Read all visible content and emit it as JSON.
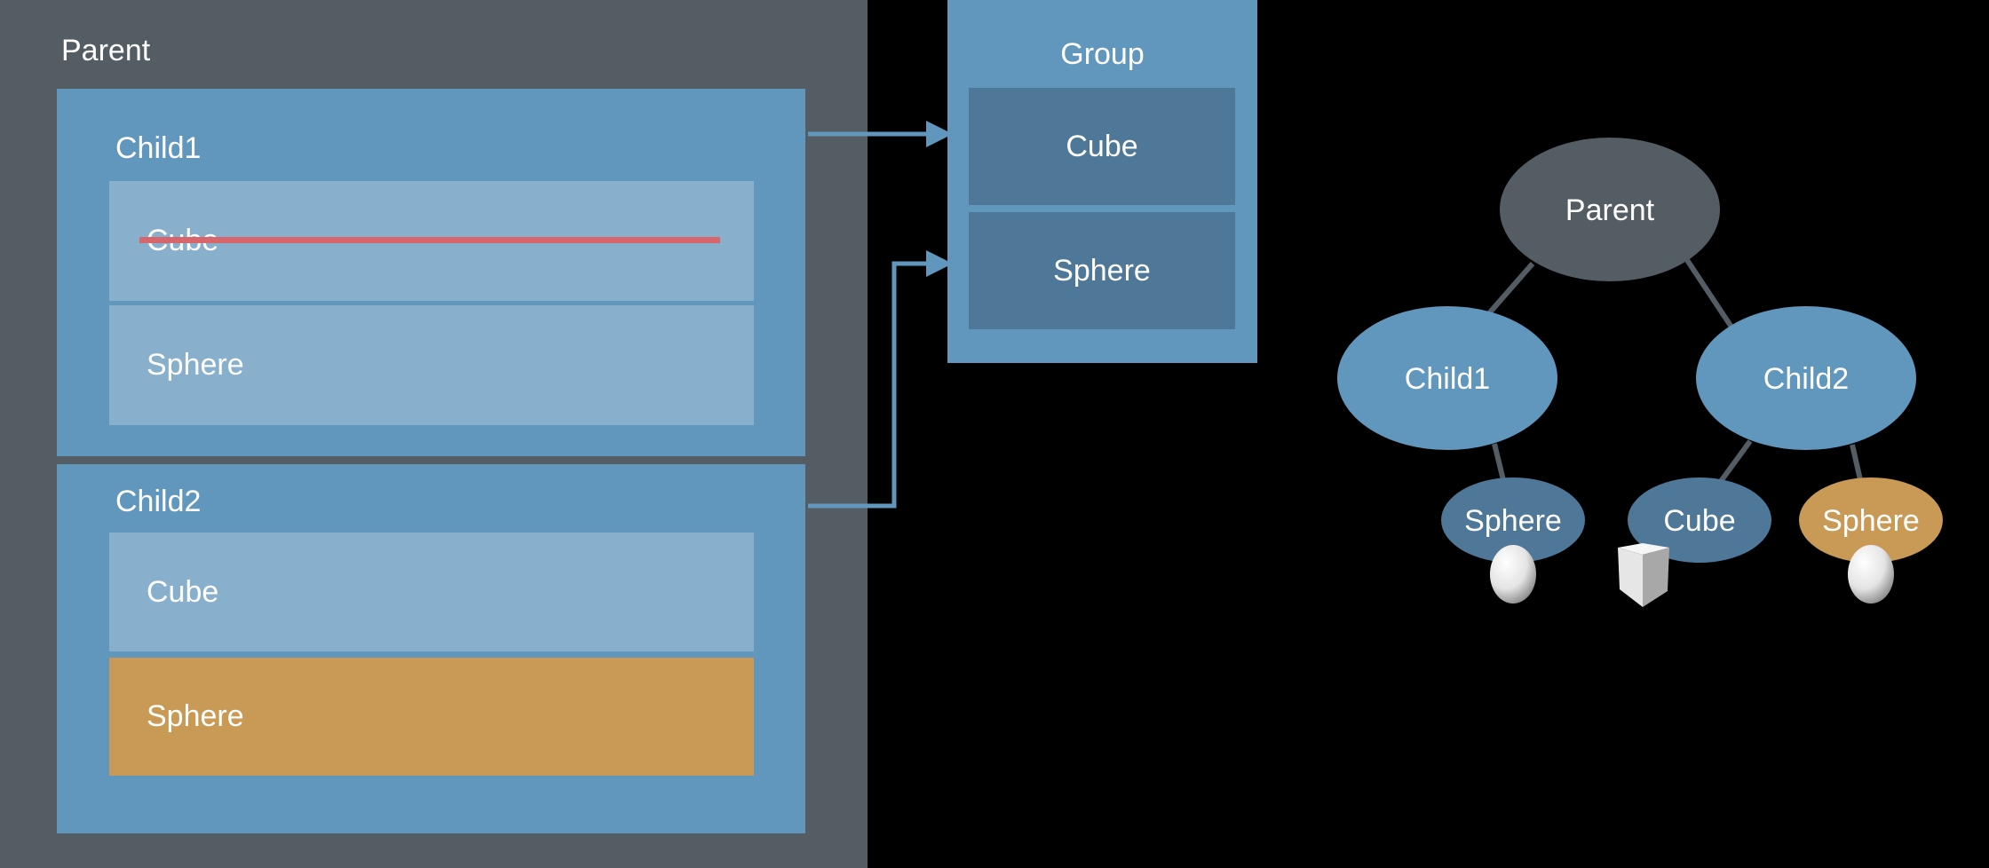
{
  "left": {
    "parent_label": "Parent",
    "children": [
      {
        "label": "Child1",
        "items": [
          {
            "label": "Cube",
            "struck": true
          },
          {
            "label": "Sphere"
          }
        ]
      },
      {
        "label": "Child2",
        "items": [
          {
            "label": "Cube"
          },
          {
            "label": "Sphere",
            "highlighted": true
          }
        ]
      }
    ]
  },
  "group": {
    "label": "Group",
    "items": [
      "Cube",
      "Sphere"
    ]
  },
  "tree": {
    "root": "Parent",
    "child1": "Child1",
    "child2": "Child2",
    "child1_leaf": "Sphere",
    "child2_leaf1": "Cube",
    "child2_leaf2": "Sphere"
  },
  "colors": {
    "panel": "#545c64",
    "box": "#6297bd",
    "row": "#88afcc",
    "highlight": "#c99a55",
    "group_cell": "#4f7898",
    "strike": "#d6666c"
  }
}
